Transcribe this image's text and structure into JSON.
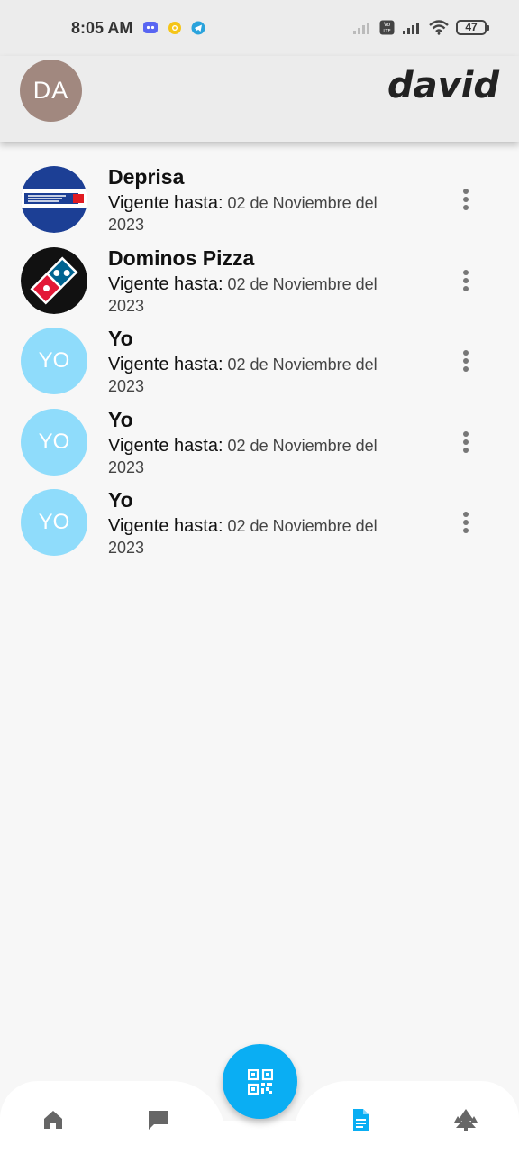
{
  "status_bar": {
    "time": "8:05 AM",
    "notifications": [
      "discord-icon",
      "coin-icon",
      "telegram-icon"
    ],
    "battery": "47",
    "network_badge": "Vo LTE"
  },
  "header": {
    "avatar_initials": "DA",
    "username": "david",
    "avatar_color": "#a1887f"
  },
  "list": {
    "items": [
      {
        "title": "Deprisa",
        "label": "Vigente hasta:",
        "date": "02 de Noviembre del 2023",
        "avatar": "deprisa-logo"
      },
      {
        "title": "Dominos Pizza",
        "label": "Vigente hasta:",
        "date": "02 de Noviembre del 2023",
        "avatar": "dominos-logo"
      },
      {
        "title": "Yo",
        "label": "Vigente hasta:",
        "date": "02 de Noviembre del 2023",
        "avatar_text": "YO"
      },
      {
        "title": "Yo",
        "label": "Vigente hasta:",
        "date": "02 de Noviembre del 2023",
        "avatar_text": "YO"
      },
      {
        "title": "Yo",
        "label": "Vigente hasta:",
        "date": "02 de Noviembre del 2023",
        "avatar_text": "YO"
      }
    ]
  },
  "bottom_nav": {
    "items": [
      "home-icon",
      "chat-icon",
      "document-icon",
      "trees-icon"
    ],
    "active": "document-icon",
    "fab_icon": "qr-code-icon",
    "accent": "#0aaef3"
  }
}
